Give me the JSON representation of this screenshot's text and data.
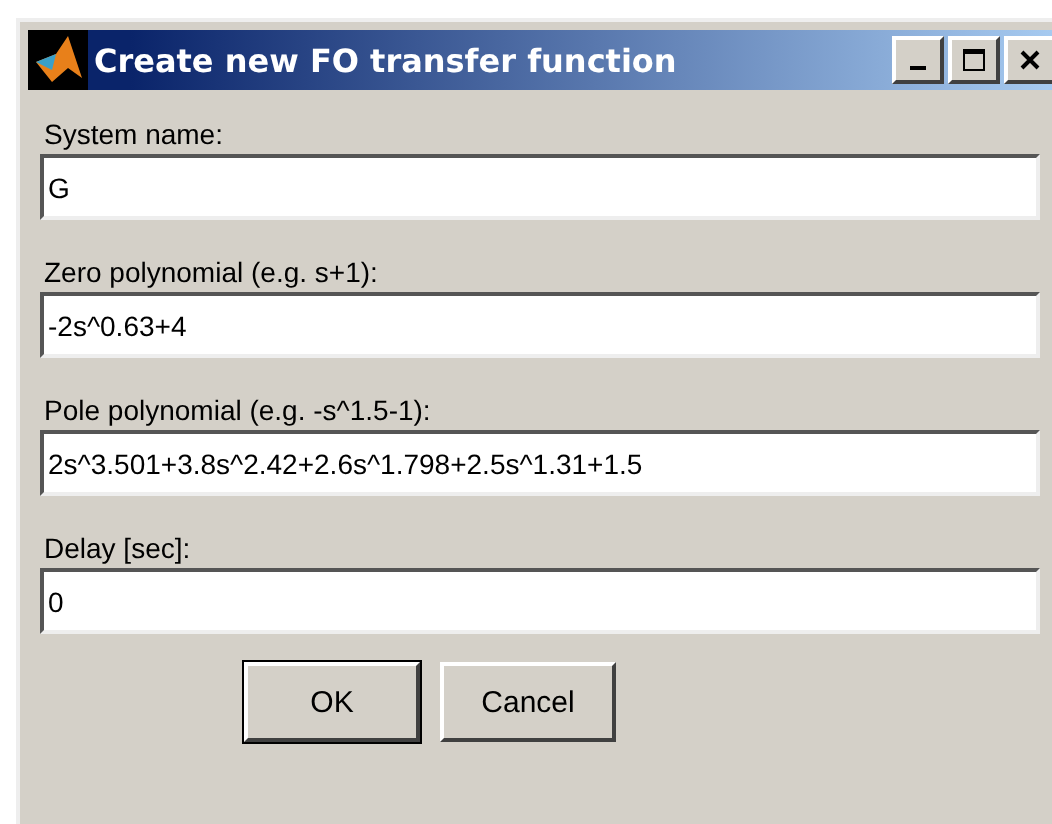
{
  "window": {
    "title": "Create new FO transfer function"
  },
  "fields": [
    {
      "label": "System name:",
      "value": "G"
    },
    {
      "label": "Zero polynomial (e.g. s+1):",
      "value": "-2s^0.63+4"
    },
    {
      "label": "Pole polynomial (e.g. -s^1.5-1):",
      "value": "2s^3.501+3.8s^2.42+2.6s^1.798+2.5s^1.31+1.5"
    },
    {
      "label": "Delay [sec]:",
      "value": "0"
    }
  ],
  "buttons": [
    "OK",
    "Cancel"
  ]
}
